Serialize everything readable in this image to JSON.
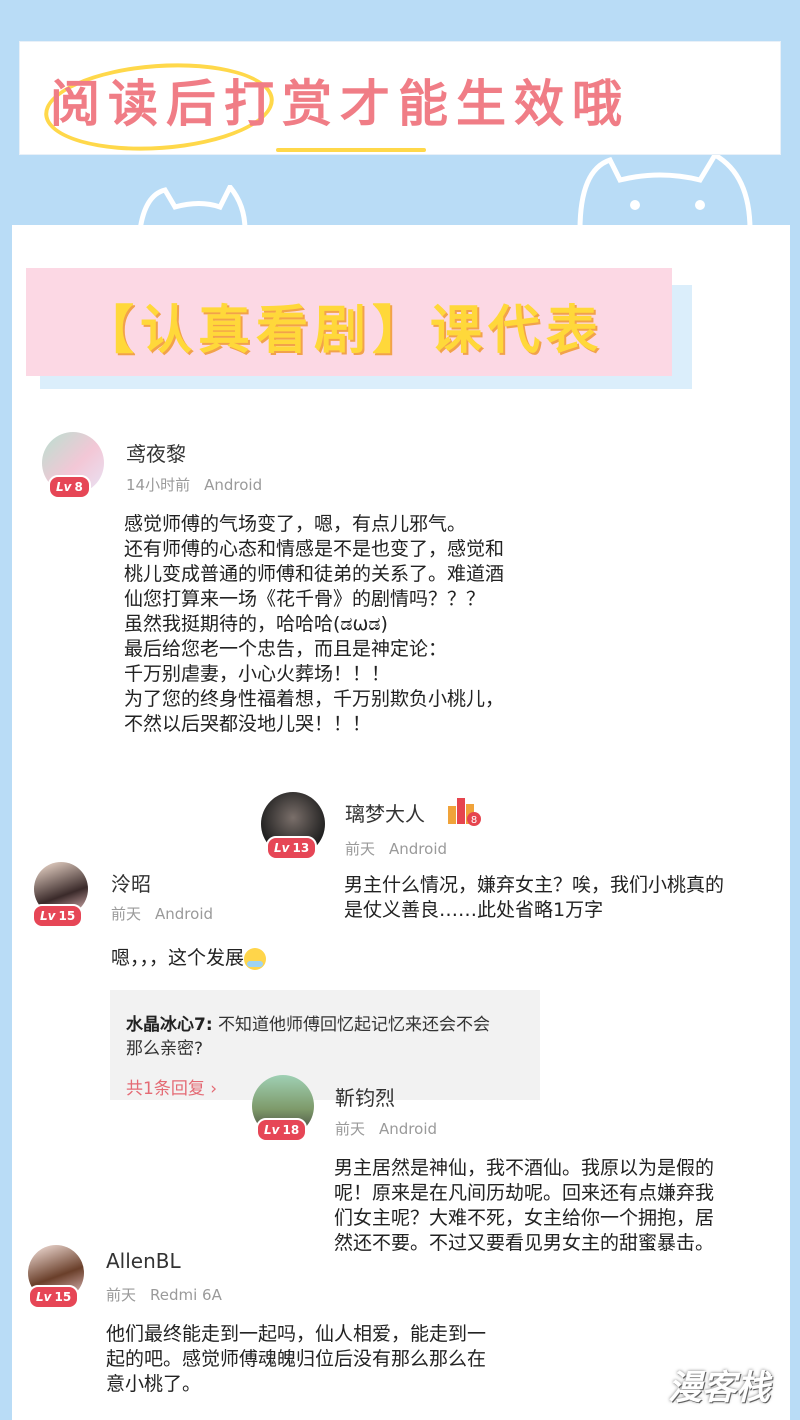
{
  "banner": {
    "title": "阅读后打赏才能生效哦"
  },
  "tag": {
    "label": "【认真看剧】课代表"
  },
  "comments": [
    {
      "name": "鸢夜黎",
      "level": "8",
      "time": "14小时前",
      "device": "Android",
      "lines": [
        "感觉师傅的气场变了，嗯，有点儿邪气。",
        "还有师傅的心态和情感是不是也变了，感觉和",
        "桃儿变成普通的师傅和徒弟的关系了。难道酒",
        "仙您打算来一场《花千骨》的剧情吗？？？",
        "虽然我挺期待的，哈哈哈(ಡωಡ)",
        "最后给您老一个忠告，而且是神定论：",
        "千万别虐妻，小心火葬场！！！",
        "为了您的终身性福着想，千万别欺负小桃儿，",
        "不然以后哭都没地儿哭！！！"
      ]
    },
    {
      "name": "璃梦大人",
      "level": "13",
      "badge": "8",
      "time": "前天",
      "device": "Android",
      "lines": [
        "男主什么情况，嫌弃女主？唉，我们小桃真的",
        "是仗义善良……此处省略1万字"
      ]
    },
    {
      "name": "泠昭",
      "level": "15",
      "time": "前天",
      "device": "Android",
      "text": "嗯，，，这个发展",
      "reply": {
        "author": "水晶冰心7:",
        "line1": "不知道他师傅回忆起记忆来还会不会",
        "line2": "那么亲密?",
        "more": "共1条回复 ›"
      }
    },
    {
      "name": "靳钧烈",
      "level": "18",
      "time": "前天",
      "device": "Android",
      "lines": [
        "男主居然是神仙，我不酒仙。我原以为是假的",
        "呢！原来是在凡间历劫呢。回来还有点嫌弃我",
        "们女主呢？大难不死，女主给你一个拥抱，居",
        "然还不要。不过又要看见男女主的甜蜜暴击。"
      ]
    },
    {
      "name": "AllenBL",
      "level": "15",
      "time": "前天",
      "device": "Redmi 6A",
      "lines": [
        "他们最终能走到一起吗，仙人相爱，能走到一",
        "起的吧。感觉师傅魂魄归位后没有那么那么在",
        "意小桃了。"
      ]
    }
  ],
  "lv_prefix": "Lv",
  "watermark": "漫客栈"
}
